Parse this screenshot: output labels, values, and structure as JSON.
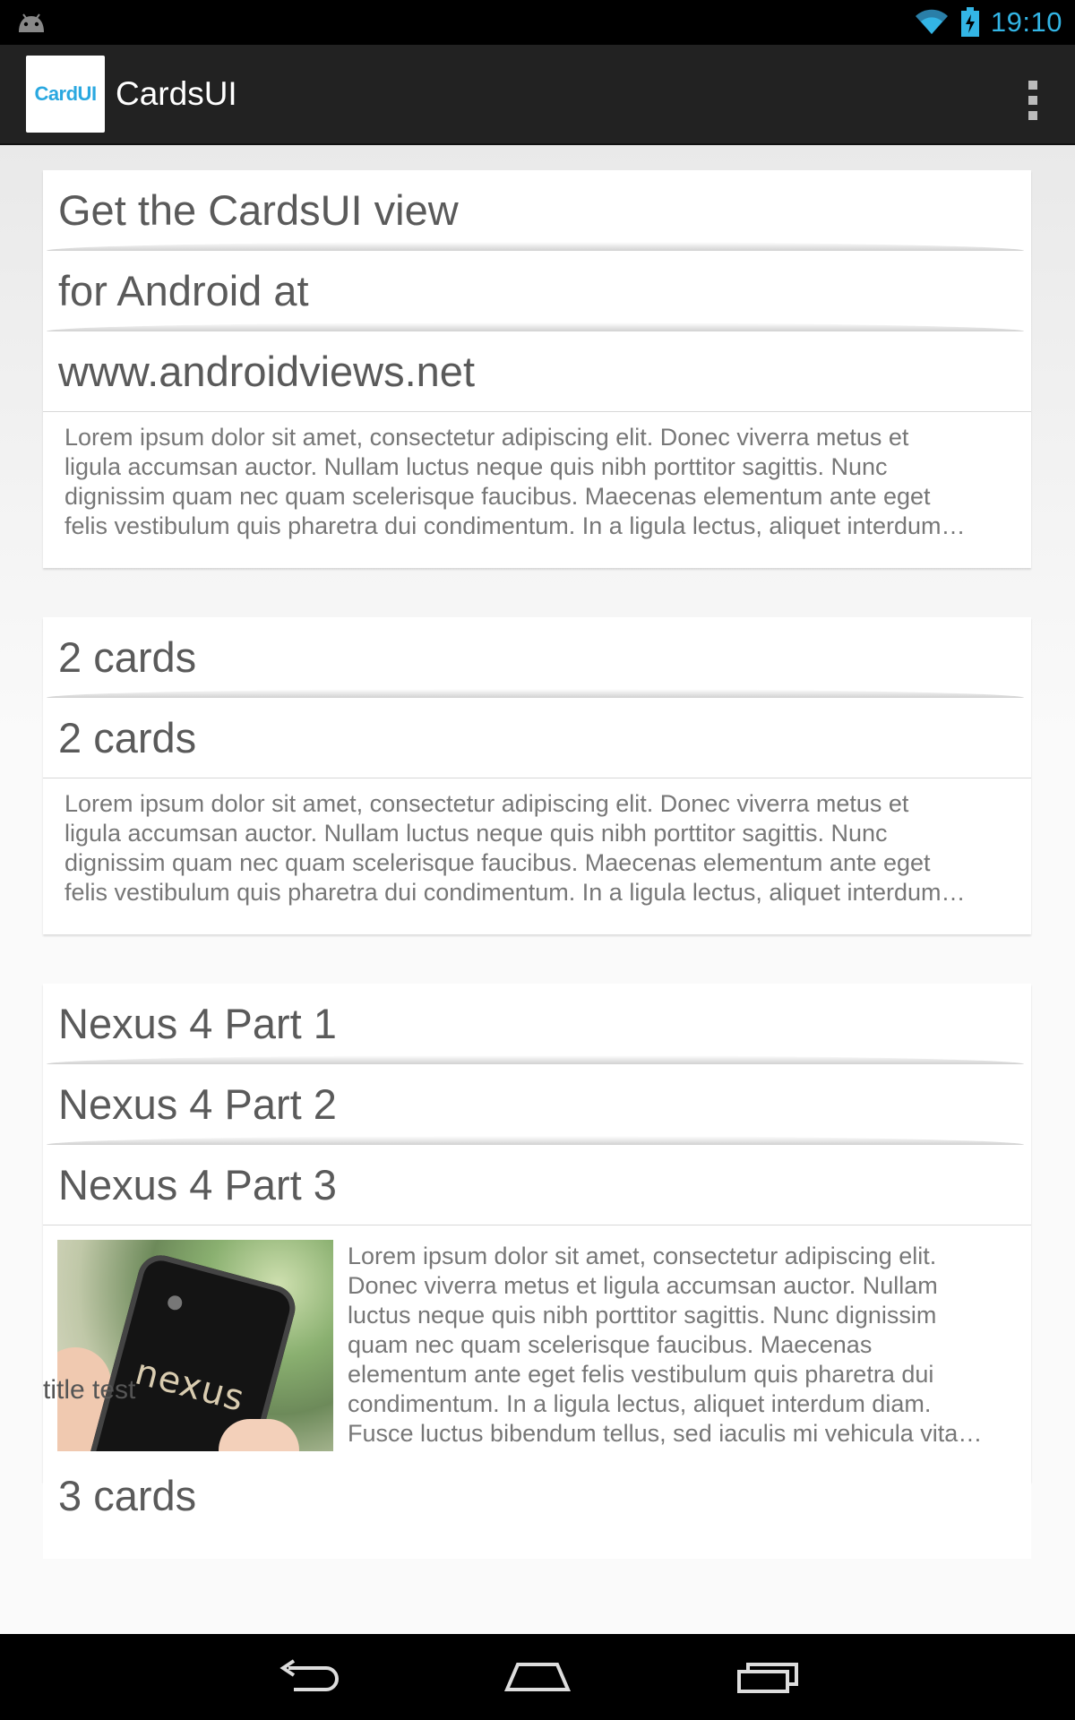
{
  "status_bar": {
    "time": "19:10",
    "icons": [
      "android-notification-icon",
      "wifi-icon",
      "battery-charging-icon"
    ]
  },
  "action_bar": {
    "logo_text": "CardUI",
    "title": "CardsUI",
    "menu_icon": "overflow-menu-icon"
  },
  "stacks": [
    {
      "headers": [
        "Get the CardsUI view",
        "for Android at",
        "www.androidviews.net"
      ],
      "body_lines": [
        "Lorem ipsum dolor sit amet, consectetur adipiscing elit. Donec viverra metus et",
        "ligula accumsan auctor. Nullam luctus neque quis nibh porttitor sagittis. Nunc",
        "dignissim quam nec quam scelerisque faucibus. Maecenas elementum ante eget",
        "felis vestibulum quis pharetra dui condimentum. In a ligula lectus, aliquet interdum…"
      ]
    },
    {
      "headers": [
        "2 cards",
        "2 cards"
      ],
      "body_lines": [
        "Lorem ipsum dolor sit amet, consectetur adipiscing elit. Donec viverra metus et",
        "ligula accumsan auctor. Nullam luctus neque quis nibh porttitor sagittis. Nunc",
        "dignissim quam nec quam scelerisque faucibus. Maecenas elementum ante eget",
        "felis vestibulum quis pharetra dui condimentum. In a ligula lectus, aliquet interdum…"
      ]
    },
    {
      "headers": [
        "Nexus 4 Part 1",
        "Nexus 4 Part 2",
        "Nexus 4 Part 3"
      ],
      "image_caption": "nexus",
      "body_lines": [
        "Lorem ipsum dolor sit amet, consectetur adipiscing elit.",
        "Donec viverra metus et ligula accumsan auctor. Nullam",
        "luctus neque quis nibh porttitor sagittis. Nunc dignissim",
        "quam nec quam scelerisque faucibus. Maecenas",
        "elementum ante eget felis vestibulum quis pharetra dui",
        "condimentum. In a ligula lectus, aliquet interdum diam.",
        "Fusce luctus bibendum tellus, sed iaculis mi vehicula vita…"
      ]
    }
  ],
  "section_title": "title test",
  "partial_card_title": "3 cards",
  "nav_bar": {
    "buttons": [
      "back-icon",
      "home-icon",
      "recents-icon"
    ]
  },
  "colors": {
    "accent": "#33b5e5",
    "logo_text": "#2aa8e0",
    "action_bar": "#222222"
  }
}
